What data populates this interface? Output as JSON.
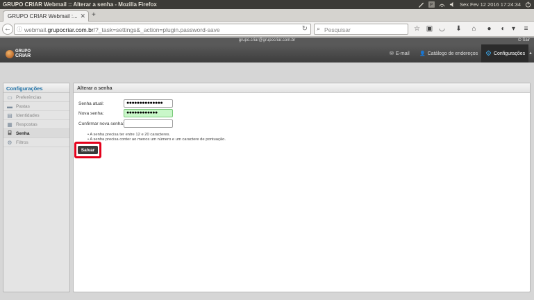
{
  "os": {
    "window_title": "GRUPO CRIAR Webmail :: Alterar a senha - Mozilla Firefox",
    "clock": "Sex Fev 12 2016 17:24:34"
  },
  "browser": {
    "tab_title": "GRUPO CRIAR Webmail :...",
    "new_tab": "+",
    "url_prefix": "webmail.",
    "url_domain": "grupocriar.com.br",
    "url_path": "/?_task=settings&_action=plugin.password-save",
    "search_placeholder": "Pesquisar"
  },
  "webmail": {
    "user_email": "grupo.criar@grupocriar.com.br",
    "logout_label": "Sair",
    "logo_line1": "GRUPO",
    "logo_line2": "CRIAR",
    "nav": {
      "email": "E-mail",
      "contacts": "Catálogo de endereços",
      "settings": "Configurações"
    },
    "sidebar": {
      "heading": "Configurações",
      "items": [
        {
          "label": "Preferências",
          "icon": "monitor-icon"
        },
        {
          "label": "Pastas",
          "icon": "folder-icon"
        },
        {
          "label": "Identidades",
          "icon": "id-card-icon"
        },
        {
          "label": "Respostas",
          "icon": "document-icon"
        },
        {
          "label": "Senha",
          "icon": "key-icon"
        },
        {
          "label": "Filtros",
          "icon": "gear-icon"
        }
      ]
    },
    "panel": {
      "heading": "Alterar a senha",
      "current_password_label": "Senha atual:",
      "current_password_value": "●●●●●●●●●●●●●●",
      "new_password_label": "Nova senha:",
      "new_password_value": "●●●●●●●●●●●●",
      "confirm_password_label": "Confirmar nova senha:",
      "confirm_password_value": "",
      "hints": [
        "A senha precisa ter entre 12 e 20 caracteres.",
        "A senha precisa conter ao menos um número e um caractere de pontuação."
      ],
      "save_label": "Salvar"
    }
  },
  "colors": {
    "highlight": "#e3001b",
    "accent": "#1b6fa5"
  }
}
